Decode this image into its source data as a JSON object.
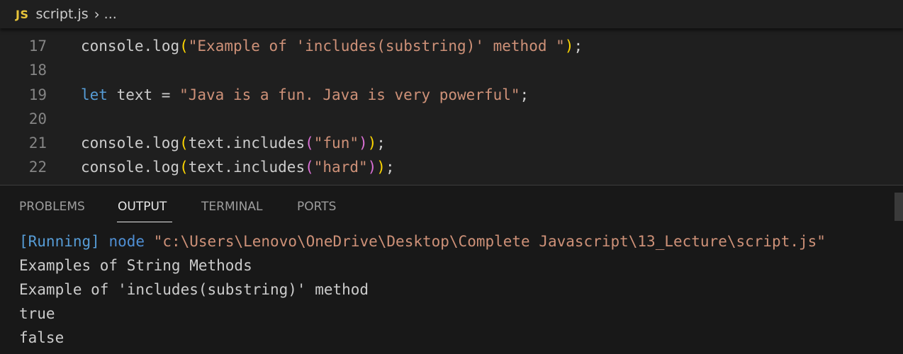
{
  "breadcrumb": {
    "icon": "JS",
    "file": "script.js",
    "separator": "›",
    "more": "..."
  },
  "editor": {
    "lines": [
      {
        "number": "17",
        "tokens": [
          {
            "t": "console",
            "c": "default"
          },
          {
            "t": ".",
            "c": "default"
          },
          {
            "t": "log",
            "c": "default"
          },
          {
            "t": "(",
            "c": "br1"
          },
          {
            "t": "\"Example of 'includes(substring)' method \"",
            "c": "str"
          },
          {
            "t": ")",
            "c": "br1"
          },
          {
            "t": ";",
            "c": "default"
          }
        ]
      },
      {
        "number": "18",
        "tokens": []
      },
      {
        "number": "19",
        "tokens": [
          {
            "t": "let",
            "c": "kw"
          },
          {
            "t": " text = ",
            "c": "default"
          },
          {
            "t": "\"Java is a fun. Java is very powerful\"",
            "c": "str"
          },
          {
            "t": ";",
            "c": "default"
          }
        ]
      },
      {
        "number": "20",
        "tokens": []
      },
      {
        "number": "21",
        "tokens": [
          {
            "t": "console.log",
            "c": "default"
          },
          {
            "t": "(",
            "c": "br1"
          },
          {
            "t": "text.includes",
            "c": "default"
          },
          {
            "t": "(",
            "c": "br2"
          },
          {
            "t": "\"fun\"",
            "c": "str"
          },
          {
            "t": ")",
            "c": "br2"
          },
          {
            "t": ")",
            "c": "br1"
          },
          {
            "t": ";",
            "c": "default"
          }
        ]
      },
      {
        "number": "22",
        "tokens": [
          {
            "t": "console.log",
            "c": "default"
          },
          {
            "t": "(",
            "c": "br1"
          },
          {
            "t": "text.includes",
            "c": "default"
          },
          {
            "t": "(",
            "c": "br2"
          },
          {
            "t": "\"hard\"",
            "c": "str"
          },
          {
            "t": ")",
            "c": "br2"
          },
          {
            "t": ")",
            "c": "br1"
          },
          {
            "t": ";",
            "c": "default"
          }
        ]
      }
    ]
  },
  "panel": {
    "tabs": [
      {
        "label": "PROBLEMS",
        "active": false
      },
      {
        "label": "OUTPUT",
        "active": true
      },
      {
        "label": "TERMINAL",
        "active": false
      },
      {
        "label": "PORTS",
        "active": false
      }
    ],
    "output": {
      "running_tag": "[Running]",
      "command": "node",
      "path": "\"c:\\Users\\Lenovo\\OneDrive\\Desktop\\Complete Javascript\\13_Lecture\\script.js\"",
      "lines": [
        "Examples of String Methods",
        "Example of 'includes(substring)' method",
        "true",
        "false"
      ]
    }
  },
  "colors": {
    "background": "#1f1f1f",
    "panel_background": "#181818",
    "string": "#ce9178",
    "keyword": "#569cd6",
    "bracket_level1": "#ffd700",
    "bracket_level2": "#da70d6",
    "line_number": "#858585",
    "js_icon": "#e8c53a"
  }
}
